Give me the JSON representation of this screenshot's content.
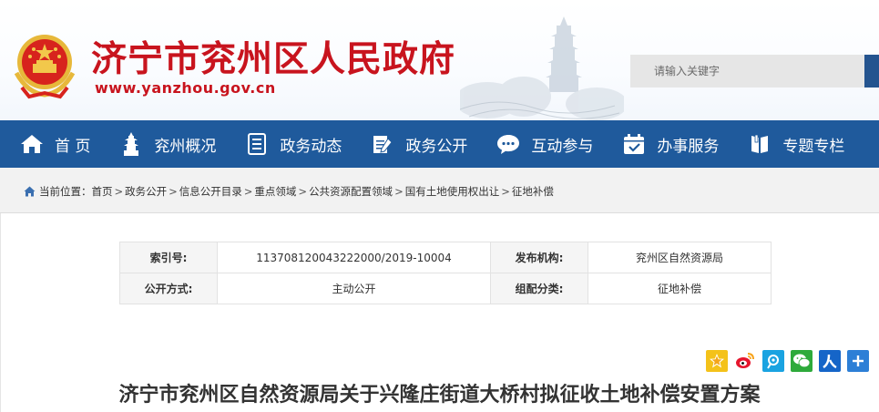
{
  "header": {
    "title": "济宁市兖州区人民政府",
    "url": "www.yanzhou.gov.cn",
    "search_placeholder": "请输入关键字"
  },
  "nav": {
    "items": [
      {
        "label": "首 页",
        "icon": "home-icon"
      },
      {
        "label": "兖州概况",
        "icon": "pagoda-icon"
      },
      {
        "label": "政务动态",
        "icon": "document-list-icon"
      },
      {
        "label": "政务公开",
        "icon": "clipboard-pen-icon"
      },
      {
        "label": "互动参与",
        "icon": "chat-bubble-icon"
      },
      {
        "label": "办事服务",
        "icon": "calendar-check-icon"
      },
      {
        "label": "专题专栏",
        "icon": "book-icon"
      }
    ]
  },
  "breadcrumb": {
    "prefix": "当前位置：",
    "items": [
      "首页",
      "政务公开",
      "信息公开目录",
      "重点领域",
      "公共资源配置领域",
      "国有土地使用权出让",
      "征地补偿"
    ],
    "separator": ">"
  },
  "meta": {
    "index_label": "索引号:",
    "index_value": "113708120043222000/2019-10004",
    "publisher_label": "发布机构:",
    "publisher_value": "兖州区自然资源局",
    "disclosure_label": "公开方式:",
    "disclosure_value": "主动公开",
    "category_label": "组配分类:",
    "category_value": "征地补偿"
  },
  "share_icons": [
    "qzone-star-icon",
    "weibo-icon",
    "tencent-weibo-icon",
    "wechat-icon",
    "renren-icon",
    "more-plus-icon"
  ],
  "document": {
    "title": "济宁市兖州区自然资源局关于兴隆庄街道大桥村拟征收土地补偿安置方案"
  },
  "colors": {
    "brand_red": "#c8141e",
    "nav_blue": "#1f5a9c",
    "search_button": "#24548f"
  }
}
